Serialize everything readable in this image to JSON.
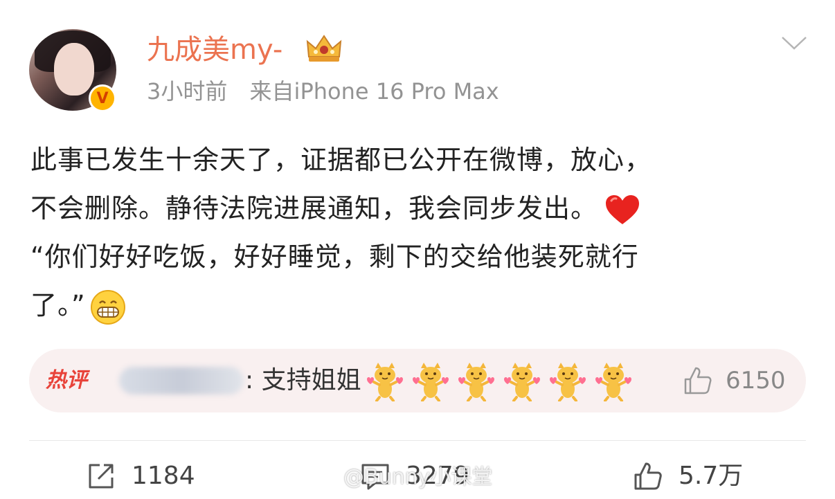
{
  "post": {
    "author": {
      "name": "九成美my-",
      "verified_badge": "V",
      "crown_icon": "crown-icon"
    },
    "meta": {
      "time": "3小时前",
      "source": "来自iPhone 16 Pro Max"
    },
    "text_lines": [
      "此事已发生十余天了，证据都已公开在微博，放心，",
      "不会删除。静待法院进展通知，我会同步发出。",
      "“你们好好吃饭，好好睡觉，剩下的交给他装死就行",
      "了。”"
    ],
    "emojis": {
      "line2_end": "heart-icon",
      "line4_end": "grin-icon"
    }
  },
  "hot_comment": {
    "tag": "热评",
    "text": ": 支持姐姐",
    "likes": "6150",
    "sticker_count": 6
  },
  "actions": {
    "repost": "1184",
    "comment": "3279",
    "like": "5.7万"
  },
  "watermark": "@Bunny小课堂",
  "colors": {
    "username": "#eb7350",
    "meta": "#939393",
    "hot_bg": "#f9f0f0",
    "hot_tag": "#e8433a",
    "badge": "#ffb400"
  }
}
